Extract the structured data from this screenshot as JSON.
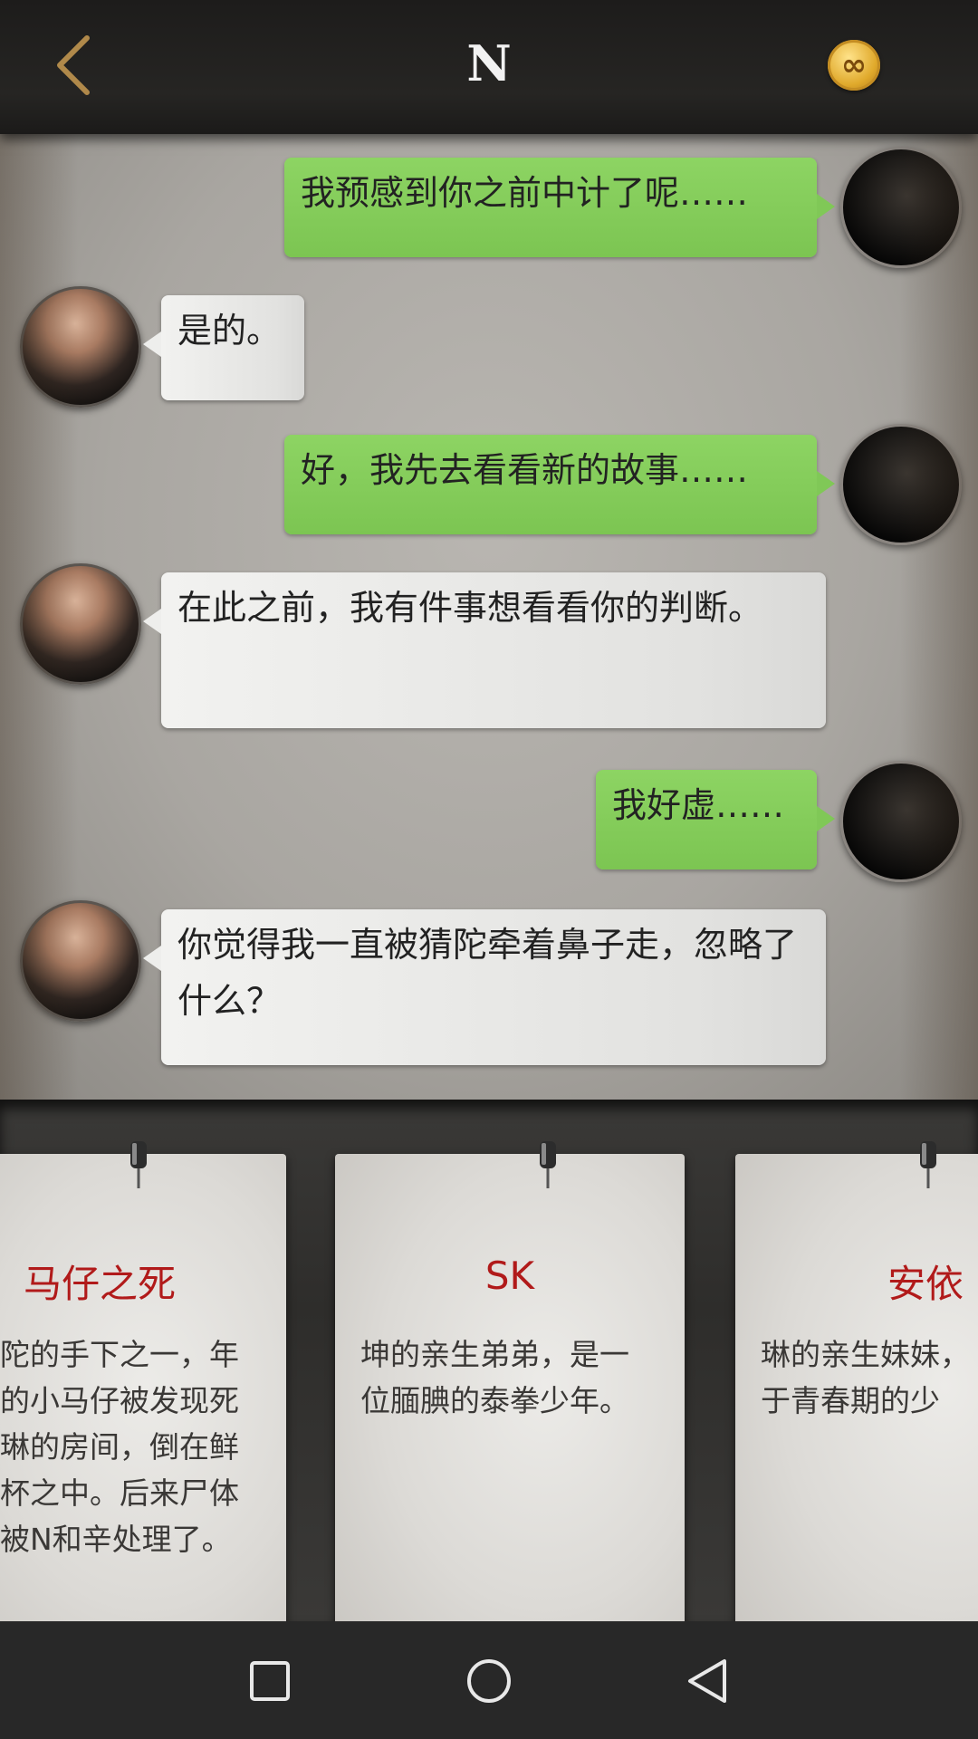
{
  "header": {
    "title": "N",
    "coin_symbol": "∞"
  },
  "messages": [
    {
      "side": "right",
      "text": "我预感到你之前中计了呢……"
    },
    {
      "side": "left",
      "text": "是的。"
    },
    {
      "side": "right",
      "text": "好，我先去看看新的故事……"
    },
    {
      "side": "left",
      "text": "在此之前，我有件事想看看你的判断。"
    },
    {
      "side": "right",
      "text": "我好虚……"
    },
    {
      "side": "left",
      "text": "你觉得我一直被猜陀牵着鼻子走，忽略了什么？"
    }
  ],
  "cards": [
    {
      "title": "马仔之死",
      "desc": "陀的手下之一，年\n的小马仔被发现死\n琳的房间，倒在鲜\n杯之中。后来尸体\n被N和辛处理了。"
    },
    {
      "title": "SK",
      "desc": "坤的亲生弟弟，是一\n位腼腆的泰拳少年。"
    },
    {
      "title": "安依",
      "desc": "琳的亲生妹妹，\n于青春期的少"
    }
  ],
  "colors": {
    "accent_green": "#7cc552",
    "card_title_red": "#b11a1a",
    "coin_gold": "#e0a92b"
  }
}
